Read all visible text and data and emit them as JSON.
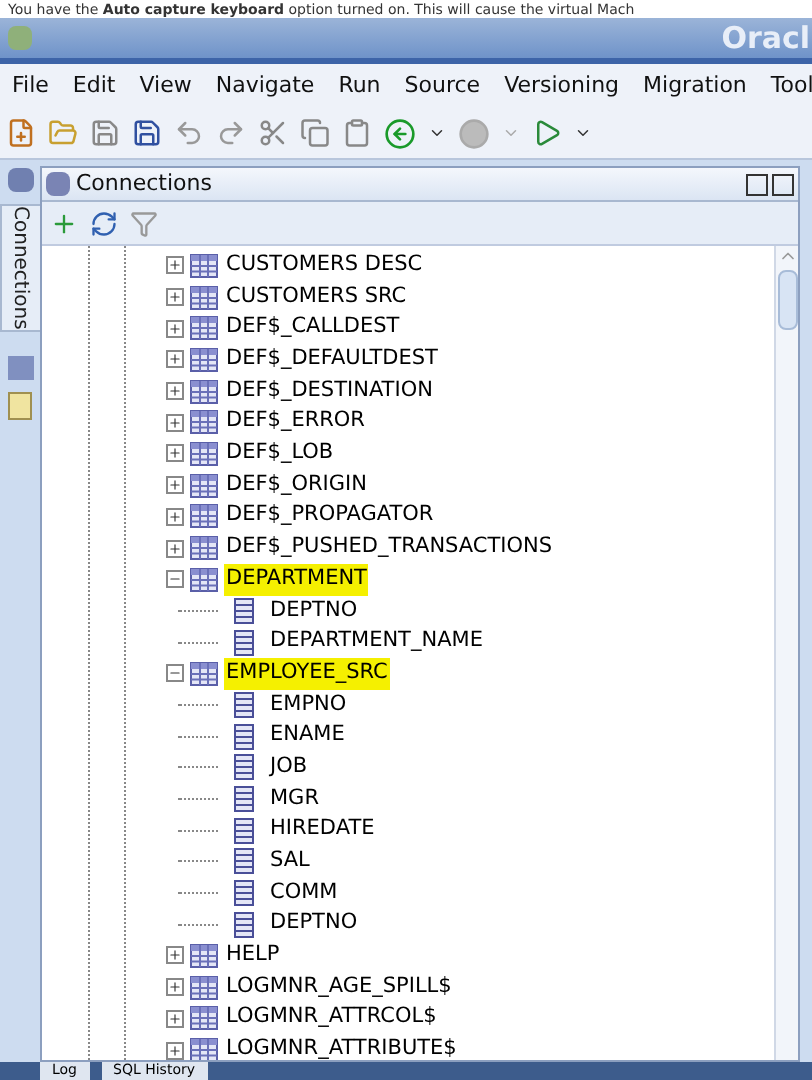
{
  "notice": "You have the **Auto capture keyboard** option turned on. This will cause the virtual Mach",
  "window": {
    "title": "Oracl"
  },
  "menu": [
    "File",
    "Edit",
    "View",
    "Navigate",
    "Run",
    "Source",
    "Versioning",
    "Migration",
    "Tool"
  ],
  "side_tab": "Connections",
  "panel": {
    "title": "Connections"
  },
  "tree": [
    {
      "kind": "table",
      "label": "CUSTOMERS DESC",
      "expanded": false,
      "highlighted": false
    },
    {
      "kind": "table",
      "label": "CUSTOMERS SRC",
      "expanded": false,
      "highlighted": false
    },
    {
      "kind": "table",
      "label": "DEF$_CALLDEST",
      "expanded": false,
      "highlighted": false
    },
    {
      "kind": "table",
      "label": "DEF$_DEFAULTDEST",
      "expanded": false,
      "highlighted": false
    },
    {
      "kind": "table",
      "label": "DEF$_DESTINATION",
      "expanded": false,
      "highlighted": false
    },
    {
      "kind": "table",
      "label": "DEF$_ERROR",
      "expanded": false,
      "highlighted": false
    },
    {
      "kind": "table",
      "label": "DEF$_LOB",
      "expanded": false,
      "highlighted": false
    },
    {
      "kind": "table",
      "label": "DEF$_ORIGIN",
      "expanded": false,
      "highlighted": false
    },
    {
      "kind": "table",
      "label": "DEF$_PROPAGATOR",
      "expanded": false,
      "highlighted": false
    },
    {
      "kind": "table",
      "label": "DEF$_PUSHED_TRANSACTIONS",
      "expanded": false,
      "highlighted": false
    },
    {
      "kind": "table",
      "label": "DEPARTMENT",
      "expanded": true,
      "highlighted": true,
      "children": [
        {
          "kind": "column",
          "label": "DEPTNO"
        },
        {
          "kind": "column",
          "label": "DEPARTMENT_NAME"
        }
      ]
    },
    {
      "kind": "table",
      "label": "EMPLOYEE_SRC",
      "expanded": true,
      "highlighted": true,
      "children": [
        {
          "kind": "column",
          "label": "EMPNO"
        },
        {
          "kind": "column",
          "label": "ENAME"
        },
        {
          "kind": "column",
          "label": "JOB"
        },
        {
          "kind": "column",
          "label": "MGR"
        },
        {
          "kind": "column",
          "label": "HIREDATE"
        },
        {
          "kind": "column",
          "label": "SAL"
        },
        {
          "kind": "column",
          "label": "COMM"
        },
        {
          "kind": "column",
          "label": "DEPTNO"
        }
      ]
    },
    {
      "kind": "table",
      "label": "HELP",
      "expanded": false,
      "highlighted": false
    },
    {
      "kind": "table",
      "label": "LOGMNR_AGE_SPILL$",
      "expanded": false,
      "highlighted": false
    },
    {
      "kind": "table",
      "label": "LOGMNR_ATTRCOL$",
      "expanded": false,
      "highlighted": false
    },
    {
      "kind": "table",
      "label": "LOGMNR_ATTRIBUTE$",
      "expanded": false,
      "highlighted": false
    }
  ],
  "bottom_tabs": [
    "Log",
    "SQL History"
  ]
}
